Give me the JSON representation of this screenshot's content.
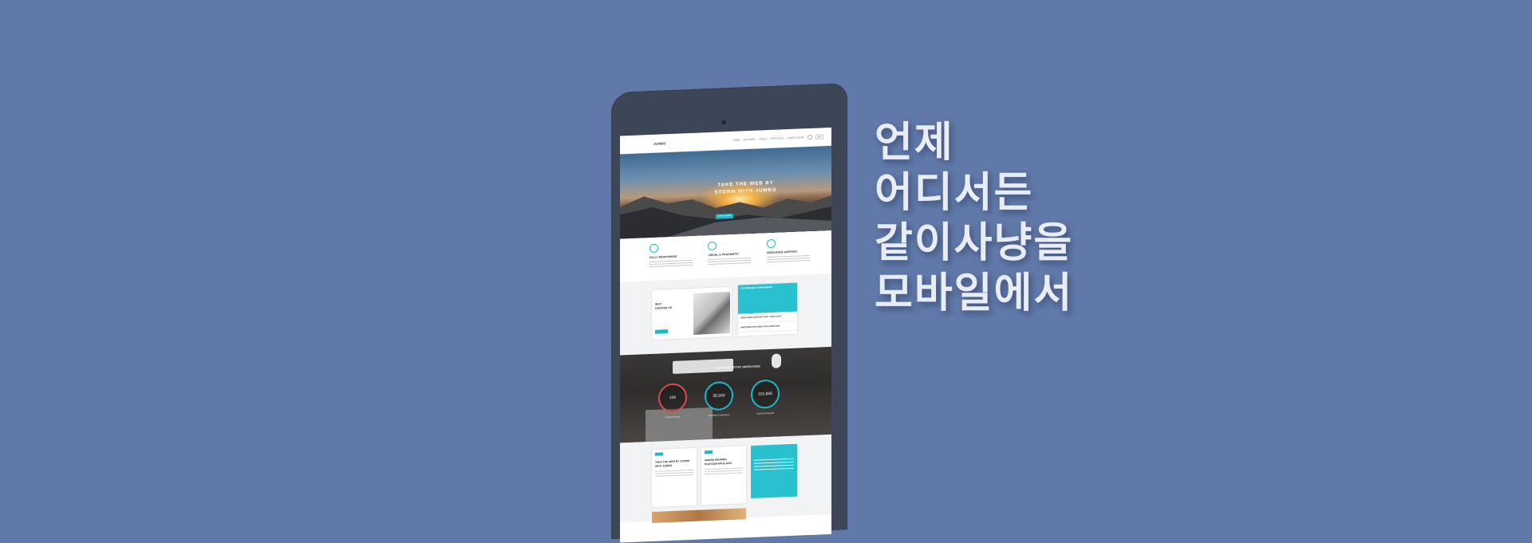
{
  "tagline": {
    "lines": [
      "언제",
      "어디서든",
      "같이사냥을",
      "모바일에서"
    ]
  },
  "tablet_site": {
    "logo": "JUMBO",
    "nav": [
      "HOME",
      "FEATURES",
      "PAGES",
      "PORTFOLIO",
      "SHORTCODES"
    ],
    "lang": "EN",
    "hero": {
      "title_line1": "TAKE THE WEB BY",
      "title_line2": "STORM WITH JUMBO",
      "button": "LEARN MORE"
    },
    "features": [
      "FULLY RESPONSIVE",
      "VISUAL & PRAGMATIC",
      "DEDICATED SUPPORT"
    ],
    "why": {
      "label_line1": "WHY",
      "label_line2": "CHOOSE US",
      "list_active": "CUSTOMIZABLE COMPONENTS",
      "list_items": [
        "DEDICATED SUPPORT FOR YOUR STAFF",
        "AWESOME FEATURES FOR EVERYONE"
      ]
    },
    "stats": {
      "heading": "WE NEVER STOP IMPROVING",
      "items": [
        {
          "value": "100",
          "label": "Content Pages"
        },
        {
          "value": "35,500",
          "label": "Satisfied Customers"
        },
        {
          "value": "101,865",
          "label": "Total Downloads"
        }
      ]
    },
    "blog": {
      "posts": [
        {
          "tag": "NEW",
          "title": "TAKE THE WEB BY STORM WITH JUMBO"
        },
        {
          "tag": "NEW",
          "title": "AWARD WINNING PHOTOGRAPHS 2015"
        }
      ]
    }
  },
  "colors": {
    "background": "#6179a9",
    "tablet_body": "#3d4656",
    "accent": "#1bb8c9",
    "tagline_text": "#e8ecf4"
  }
}
